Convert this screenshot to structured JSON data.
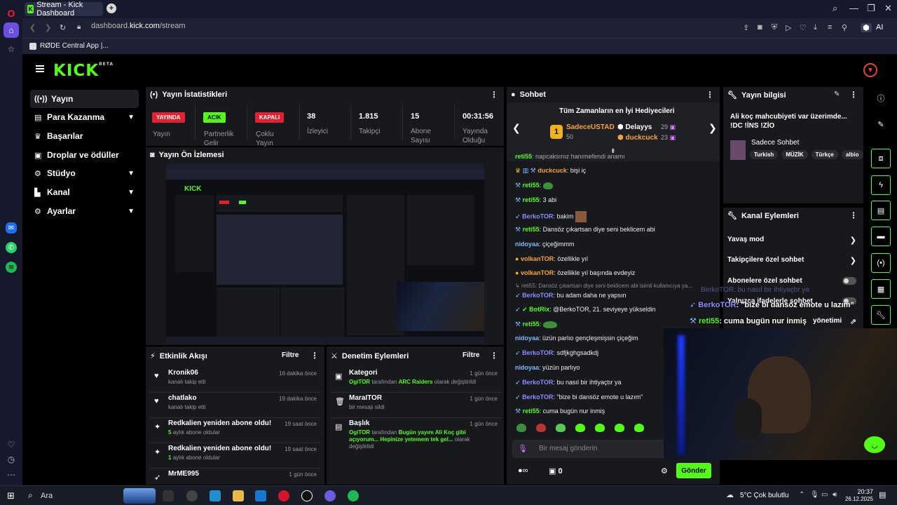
{
  "browser": {
    "tab_title": "Stream - Kick Dashboard",
    "url_prefix": "dashboard.",
    "url_domain": "kick.com",
    "url_path": "/stream",
    "bookmark": "RØDE Central App |...",
    "ai_label": "AI"
  },
  "sidebar": {
    "items": [
      {
        "label": "Yayın"
      },
      {
        "label": "Para Kazanma"
      },
      {
        "label": "Başarılar"
      },
      {
        "label": "Droplar ve ödüller"
      },
      {
        "label": "Stüdyo"
      },
      {
        "label": "Kanal"
      },
      {
        "label": "Ayarlar"
      }
    ]
  },
  "stats": {
    "title": "Yayın İstatistikleri",
    "live_badge": "YAYINDA",
    "live_label": "Yayın",
    "partner_badge": "ACIK",
    "partner_label": "Partnerlik",
    "partner_label2": "Gelir",
    "multi_badge": "KAPALI",
    "multi_label": "Çoklu",
    "multi_label2": "Yayın",
    "viewers": "38",
    "viewers_label": "İzleyici",
    "followers": "1.815",
    "followers_label": "Takipçi",
    "subs": "15",
    "subs_label": "Abone",
    "subs_label2": "Sayısı",
    "uptime": "00:31:56",
    "uptime_label": "Yayında",
    "uptime_label2": "Olduğu"
  },
  "preview": {
    "title": "Yayın Ön İzlemesi"
  },
  "activity": {
    "title": "Etkinlik Akışı",
    "filter": "Filtre",
    "rows": [
      {
        "name": "Kronik06",
        "desc": "kanalı takip etti",
        "when": "16 dakika önce"
      },
      {
        "name": "chatlako",
        "desc": "kanalı takip etti",
        "when": "19 dakika önce"
      },
      {
        "name": "Redkalien yeniden abone oldu!",
        "num": "5",
        "desc": "aylık abone oldular",
        "when": "19 saat önce"
      },
      {
        "name": "Redkalien yeniden abone oldu!",
        "num": "1",
        "desc": "aylık abone oldular",
        "when": "19 saat önce"
      },
      {
        "name": "MrME995",
        "desc": "",
        "when": "1 gün önce"
      }
    ]
  },
  "moderation": {
    "title": "Denetim Eylemleri",
    "filter": "Filtre",
    "rows": [
      {
        "name": "Kategori",
        "user": "OgiTOR",
        "mid": "tarafından",
        "val": "ARC Raiders",
        "tail": "olarak değiştirildi",
        "when": "1 gün önce"
      },
      {
        "name": "MaraITOR",
        "desc": "bir mesajı sildi",
        "when": "1 gün önce"
      },
      {
        "name": "Başlık",
        "user": "OgiTOR",
        "mid": "tarafından",
        "val": "Bugün yayını Ali Koç gibi açıyorum... Hepinize yetemem tek gel...",
        "tail": "olarak değiştirildi",
        "when": "1 gün önce"
      }
    ]
  },
  "chat": {
    "title": "Sohbet",
    "gifters_title": "Tüm Zamanların en İyi Hediyecileri",
    "gifter1": "SadeceUSTAD",
    "gifter1_count": "50",
    "gifter2": "Delayys",
    "gifter2_count": "29",
    "gifter3": "duckcuck",
    "gifter3_count": "23",
    "messages": [
      {
        "user": "reti55",
        "text": "napcaksınız hanımefendi anamı"
      },
      {
        "user": "duckcuck",
        "text": "bişi iç"
      },
      {
        "user": "reti55",
        "text": ""
      },
      {
        "user": "reti55",
        "text": "3 abi"
      },
      {
        "user": "BerkoTOR",
        "text": "bakim"
      },
      {
        "user": "reti55",
        "text": "Dansöz çıkartsan diye seni beklicem abi"
      },
      {
        "user": "nidoyaa",
        "text": "çiçeğimmm"
      },
      {
        "user": "volkanTOR",
        "text": "özellikle yıl"
      },
      {
        "user": "volkanTOR",
        "text": "özellikle yıl başında evdeyiz"
      },
      {
        "user": "",
        "text": "reti55: Dansöz çıkartsan diye seni beklicem abi isimli kullanıcıya ya..."
      },
      {
        "user": "BerkoTOR",
        "text": "bu adam daha ne yapsın"
      },
      {
        "user": "BotRix",
        "text": "@BerkoTOR, 21. seviyeye yükseldin"
      },
      {
        "user": "reti55",
        "text": ""
      },
      {
        "user": "nidoyaa",
        "text": "üzün parlıo gençleşmişsin çiçeğim"
      },
      {
        "user": "BerkoTOR",
        "text": "sdfjkghgsadkdj"
      },
      {
        "user": "nidoyaa",
        "text": "yüzün parlıyo"
      },
      {
        "user": "BerkoTOR",
        "text": "bu nasıl bir ihtiyaçtır ya"
      },
      {
        "user": "BerkoTOR",
        "text": "\"bize bi dansöz emote u lazım\""
      },
      {
        "user": "reti55",
        "text": "cuma bugün nur inmiş"
      }
    ],
    "input_placeholder": "Bir mesaj gönderin",
    "zero": "0",
    "send": "Gönder"
  },
  "info": {
    "title": "Yayın bilgisi",
    "stream_title": "Ali koç mahcubiyeti var üzerimde... !DC !İNS !ZİO",
    "category": "Sadece Sohbet",
    "tags": [
      "Turkish",
      "MÜZİK",
      "Türkçe",
      "albio"
    ]
  },
  "actions": {
    "title": "Kanal Eylemleri",
    "rows": [
      {
        "label": "Yavaş mod"
      },
      {
        "label": "Takipçilere özel sohbet"
      },
      {
        "label": "Abonelere özel sohbet"
      },
      {
        "label": "Yalnızca ifadelerle sohbet"
      },
      {
        "label": "yönetimi"
      }
    ]
  },
  "overlay": {
    "line1_user": "BerkoTOR",
    "line1_text": "bu nasıl bir ihtiyaçtır ya",
    "line2_user": "BerkoTOR",
    "line2_text": "\"bize bi dansöz emote u lazım\"",
    "line3_user": "reti55",
    "line3_text": "cuma bugün nur inmiş"
  },
  "taskbar": {
    "search": "Ara",
    "weather": "5°C  Çok bulutlu",
    "time": "20:37",
    "date": "26.12.2025"
  },
  "colors": {
    "accent": "#53fc18",
    "live": "#e2202f",
    "panel": "#18191d"
  }
}
